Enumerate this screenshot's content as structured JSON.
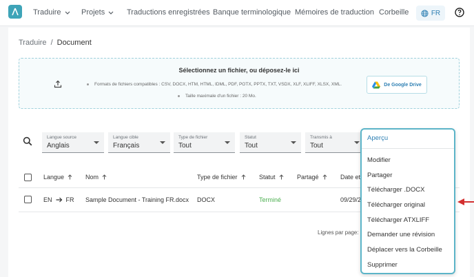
{
  "nav": {
    "items": [
      {
        "label": "Traduire",
        "dropdown": true
      },
      {
        "label": "Projets",
        "dropdown": true
      },
      {
        "label": "Traductions enregistrées",
        "dropdown": false
      },
      {
        "label": "Banque terminologique",
        "dropdown": false
      },
      {
        "label": "Mémoires de traduction",
        "dropdown": false
      },
      {
        "label": "Corbeille",
        "dropdown": false
      }
    ],
    "language": "FR"
  },
  "breadcrumb": {
    "root": "Traduire",
    "separator": "/",
    "current": "Document"
  },
  "upload": {
    "title": "Sélectionnez un fichier, ou déposez-le ici",
    "formats": "Formats de fichiers compatibles : CSV, DOCX, HTM, HTML, IDML, PDF, POTX, PPTX, TXT, VSDX, XLF, XLIFF, XLSX, XML.",
    "max_size": "Taille maximale d'un fichier : 20 Mo.",
    "google_drive_label": "De Google Drive"
  },
  "filters": [
    {
      "label": "Langue source",
      "value": "Anglais"
    },
    {
      "label": "Langue cible",
      "value": "Français"
    },
    {
      "label": "Type de fichier",
      "value": "Tout"
    },
    {
      "label": "Statut",
      "value": "Tout"
    },
    {
      "label": "Transmis à",
      "value": "Tout"
    }
  ],
  "table": {
    "headers": {
      "langue": "Langue",
      "nom": "Nom",
      "type": "Type de fichier",
      "statut": "Statut",
      "partage": "Partagé",
      "date": "Date et"
    },
    "rows": [
      {
        "source_lang": "EN",
        "target_lang": "FR",
        "name": "Sample Document - Training FR.docx",
        "type": "DOCX",
        "status": "Terminé",
        "date": "09/29/2"
      }
    ],
    "rows_per_page_label": "Lignes par page:"
  },
  "context_menu": {
    "items": [
      "Aperçu",
      "Modifier",
      "Partager",
      "Télécharger .DOCX",
      "Télécharger original",
      "Télécharger ATXLIFF",
      "Demander une révision",
      "Déplacer vers la Corbeille",
      "Supprimer"
    ]
  },
  "colors": {
    "accent": "#3ea4b8",
    "link": "#2d7fb3",
    "success": "#4caf50",
    "annotation": "#d32f2f"
  }
}
